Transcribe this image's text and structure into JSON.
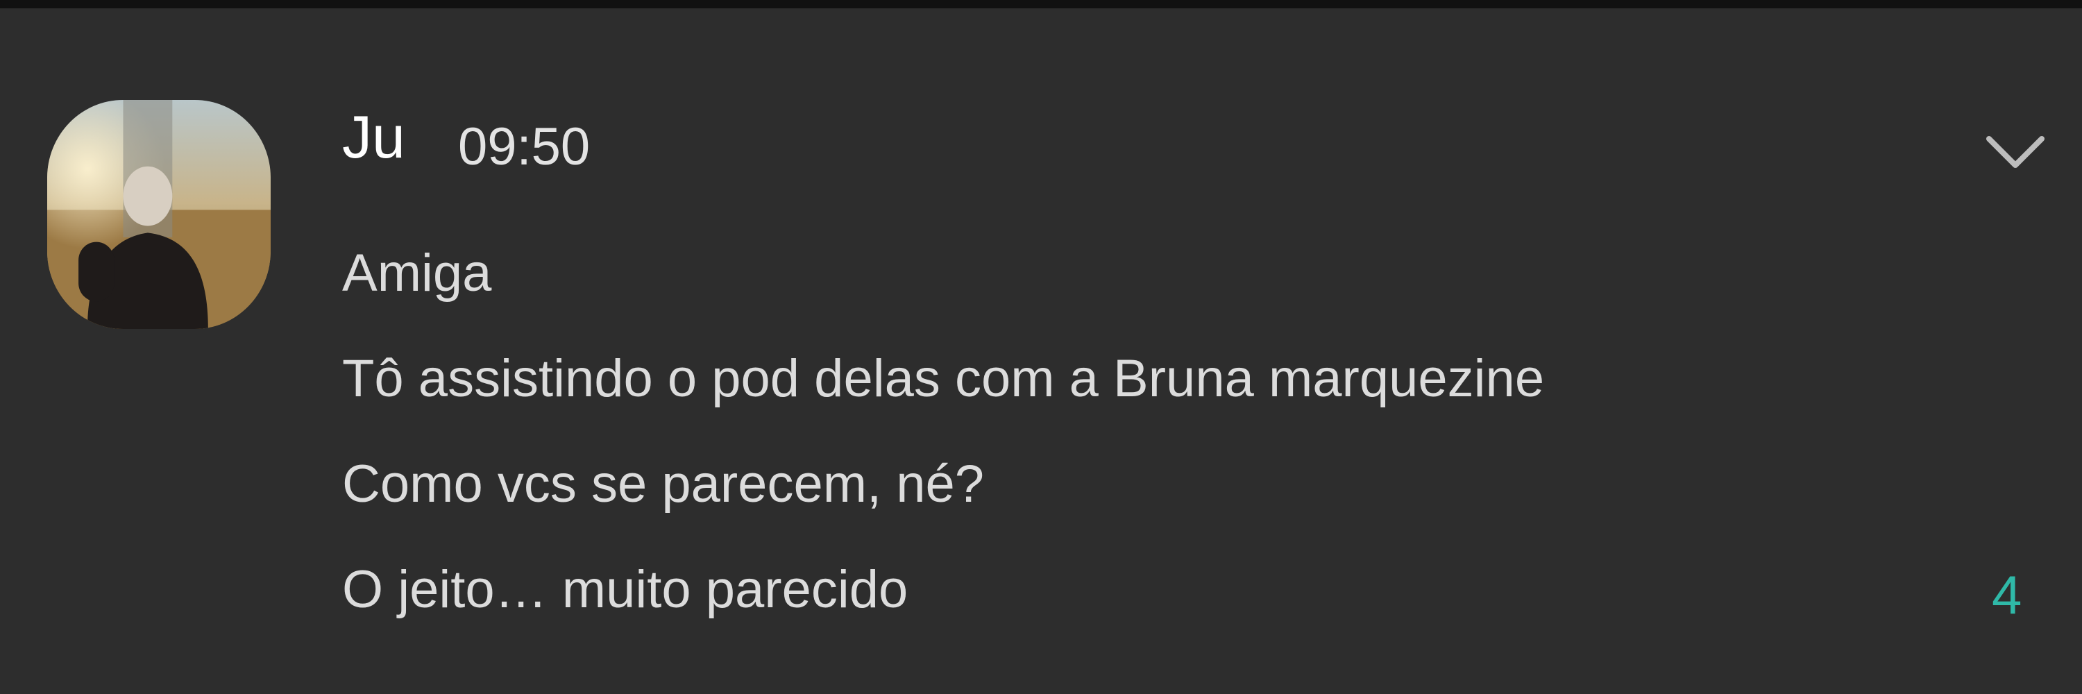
{
  "notification": {
    "sender": "Ju",
    "time": "09:50",
    "messages": [
      "Amiga",
      "Tô assistindo o pod delas com a Bruna marquezine",
      "Como vcs se parecem, né?",
      "O jeito… muito parecido"
    ],
    "unread_count": "4",
    "expand_icon": "chevron-down-icon",
    "accent_color": "#2fb9a8"
  }
}
